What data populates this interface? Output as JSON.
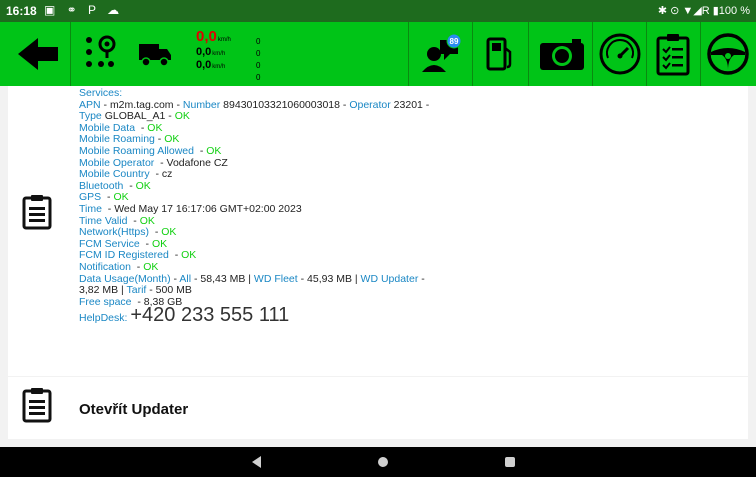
{
  "status_bar": {
    "time": "16:18",
    "left_icons": "▣ ⚭ P ☁",
    "right_text": "✱ ⊙ ▼◢R ▮100 %"
  },
  "toolbar": {
    "back_icon": "arrow-left-icon",
    "speed": {
      "value": "0,0",
      "unit": "km/h",
      "row2": "0,0",
      "row3": "0,0"
    },
    "readouts": [
      "0",
      "0",
      "0",
      "0"
    ],
    "message_badge": "89",
    "colors": {
      "background": "#00c417",
      "speed": "#e00000"
    }
  },
  "services": {
    "heading": "Services:",
    "apn_label": "APN",
    "apn_value": "m2m.tag.com",
    "number_label": "Number",
    "number_value": "89430103321060003018",
    "operator_label": "Operator",
    "operator_value": "23201",
    "type_label": "Type",
    "type_value": "GLOBAL_A1",
    "ok": "OK",
    "mobile_data_label": "Mobile Data",
    "mobile_roaming_label": "Mobile Roaming",
    "roaming_allowed_label": "Mobile Roaming Allowed",
    "mobile_operator_label": "Mobile Operator",
    "mobile_operator_value": "Vodafone CZ",
    "mobile_country_label": "Mobile Country",
    "mobile_country_value": "cz",
    "bluetooth_label": "Bluetooth",
    "gps_label": "GPS",
    "time_label": "Time",
    "time_value": "Wed May 17 16:17:06 GMT+02:00 2023",
    "time_valid_label": "Time Valid",
    "network_label": "Network(Https)",
    "fcm_service_label": "FCM Service",
    "fcm_id_label": "FCM ID Registered",
    "notification_label": "Notification",
    "data_usage_label": "Data Usage(Month)",
    "all_label": "All",
    "all_value": "58,43 MB",
    "wd_fleet_label": "WD Fleet",
    "wd_fleet_value": "45,93 MB",
    "wd_updater_label": "WD Updater",
    "wd_updater_value": "3,82 MB",
    "tarif_label": "Tarif",
    "tarif_value": "500 MB",
    "free_space_label": "Free space",
    "free_space_value": "8,38 GB",
    "helpdesk_label": "HelpDesk:",
    "helpdesk_number": "+420 233 555 111"
  },
  "updater": {
    "title": "Otevřít Updater"
  }
}
